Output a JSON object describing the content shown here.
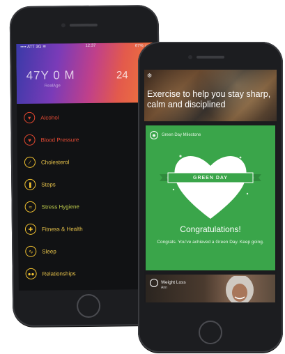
{
  "back_phone": {
    "status_bar": {
      "carrier": "•••• ATT 3G ≋",
      "time": "12:37",
      "battery": "67% ▭"
    },
    "hero": {
      "primary_value": "47Y 0 M",
      "secondary_value": "24",
      "caption": "RealAge"
    },
    "menu": [
      {
        "label": "Alcohol",
        "icon": "glass-icon",
        "color": "#e24a34"
      },
      {
        "label": "Blood Pressure",
        "icon": "heart-pulse-icon",
        "color": "#e24a34"
      },
      {
        "label": "Cholesterol",
        "icon": "slash-icon",
        "color": "#e6c24a"
      },
      {
        "label": "Steps",
        "icon": "footsteps-icon",
        "color": "#e6c24a"
      },
      {
        "label": "Stress Hygiene",
        "icon": "wave-icon",
        "color": "#b9c64a"
      },
      {
        "label": "Fitness & Health",
        "icon": "dumbbell-icon",
        "color": "#e6c24a"
      },
      {
        "label": "Sleep",
        "icon": "pulse-icon",
        "color": "#e6c24a"
      },
      {
        "label": "Relationships",
        "icon": "people-icon",
        "color": "#e6c24a"
      }
    ]
  },
  "front_phone": {
    "banner": {
      "icon": "gear-icon",
      "text": "Exercise to help you stay sharp, calm and disciplined"
    },
    "milestone_card": {
      "header": "Green Day Milestone",
      "ribbon": "GREEN DAY",
      "title": "Congratulations!",
      "message": "Congrats. You've achieved a Green Day. Keep going.",
      "accent_color": "#3aa54a"
    },
    "photo_card": {
      "label": "Weight Loss",
      "sub": "Ann"
    }
  }
}
